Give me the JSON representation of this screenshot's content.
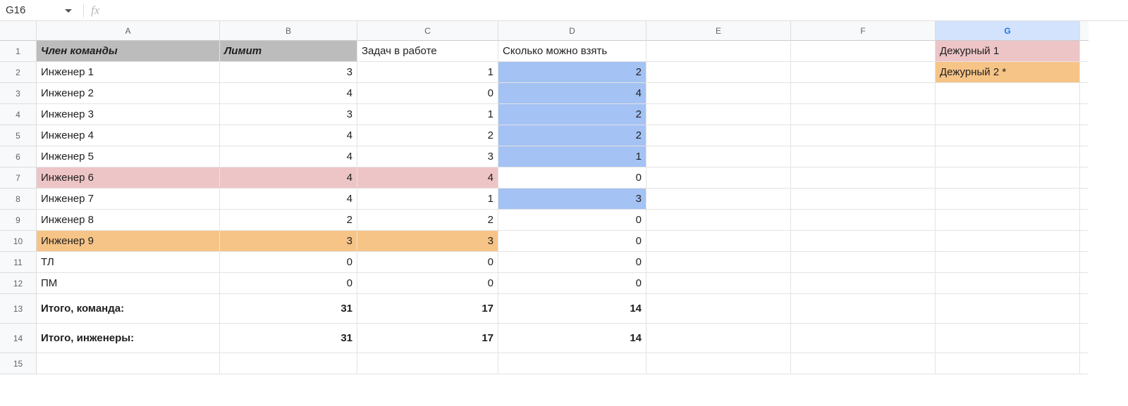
{
  "namebox": "G16",
  "formula": "",
  "fx_label": "fx",
  "columns": [
    "A",
    "B",
    "C",
    "D",
    "E",
    "F",
    "G"
  ],
  "active_col": "G",
  "row_numbers": [
    "1",
    "2",
    "3",
    "4",
    "5",
    "6",
    "7",
    "8",
    "9",
    "10",
    "11",
    "12",
    "13",
    "14",
    "15"
  ],
  "header": {
    "a": "Член команды",
    "b": "Лимит",
    "c": "Задач в работе",
    "d": "Сколько можно взять",
    "g": "Дежурный 1"
  },
  "rows": [
    {
      "a": "Инженер 1",
      "b": "3",
      "c": "1",
      "d": "2",
      "g": "Дежурный 2 *",
      "d_blue": true
    },
    {
      "a": "Инженер 2",
      "b": "4",
      "c": "0",
      "d": "4",
      "d_blue": true
    },
    {
      "a": "Инженер 3",
      "b": "3",
      "c": "1",
      "d": "2",
      "d_blue": true
    },
    {
      "a": "Инженер 4",
      "b": "4",
      "c": "2",
      "d": "2",
      "d_blue": true
    },
    {
      "a": "Инженер 5",
      "b": "4",
      "c": "3",
      "d": "1",
      "d_blue": true
    },
    {
      "a": "Инженер 6",
      "b": "4",
      "c": "4",
      "d": "0",
      "row_bg": "pink"
    },
    {
      "a": "Инженер 7",
      "b": "4",
      "c": "1",
      "d": "3",
      "d_blue": true
    },
    {
      "a": "Инженер 8",
      "b": "2",
      "c": "2",
      "d": "0"
    },
    {
      "a": "Инженер 9",
      "b": "3",
      "c": "3",
      "d": "0",
      "row_bg": "orange"
    },
    {
      "a": "ТЛ",
      "b": "0",
      "c": "0",
      "d": "0"
    },
    {
      "a": "ПМ",
      "b": "0",
      "c": "0",
      "d": "0"
    }
  ],
  "totals": [
    {
      "a": "Итого, команда:",
      "b": "31",
      "c": "17",
      "d": "14"
    },
    {
      "a": "Итого, инженеры:",
      "b": "31",
      "c": "17",
      "d": "14"
    }
  ],
  "colors": {
    "gray": "#bcbcbc",
    "blue": "#a4c2f4",
    "pink": "#eec5c7",
    "orange": "#f7c487",
    "active_col": "#d3e3fd"
  }
}
